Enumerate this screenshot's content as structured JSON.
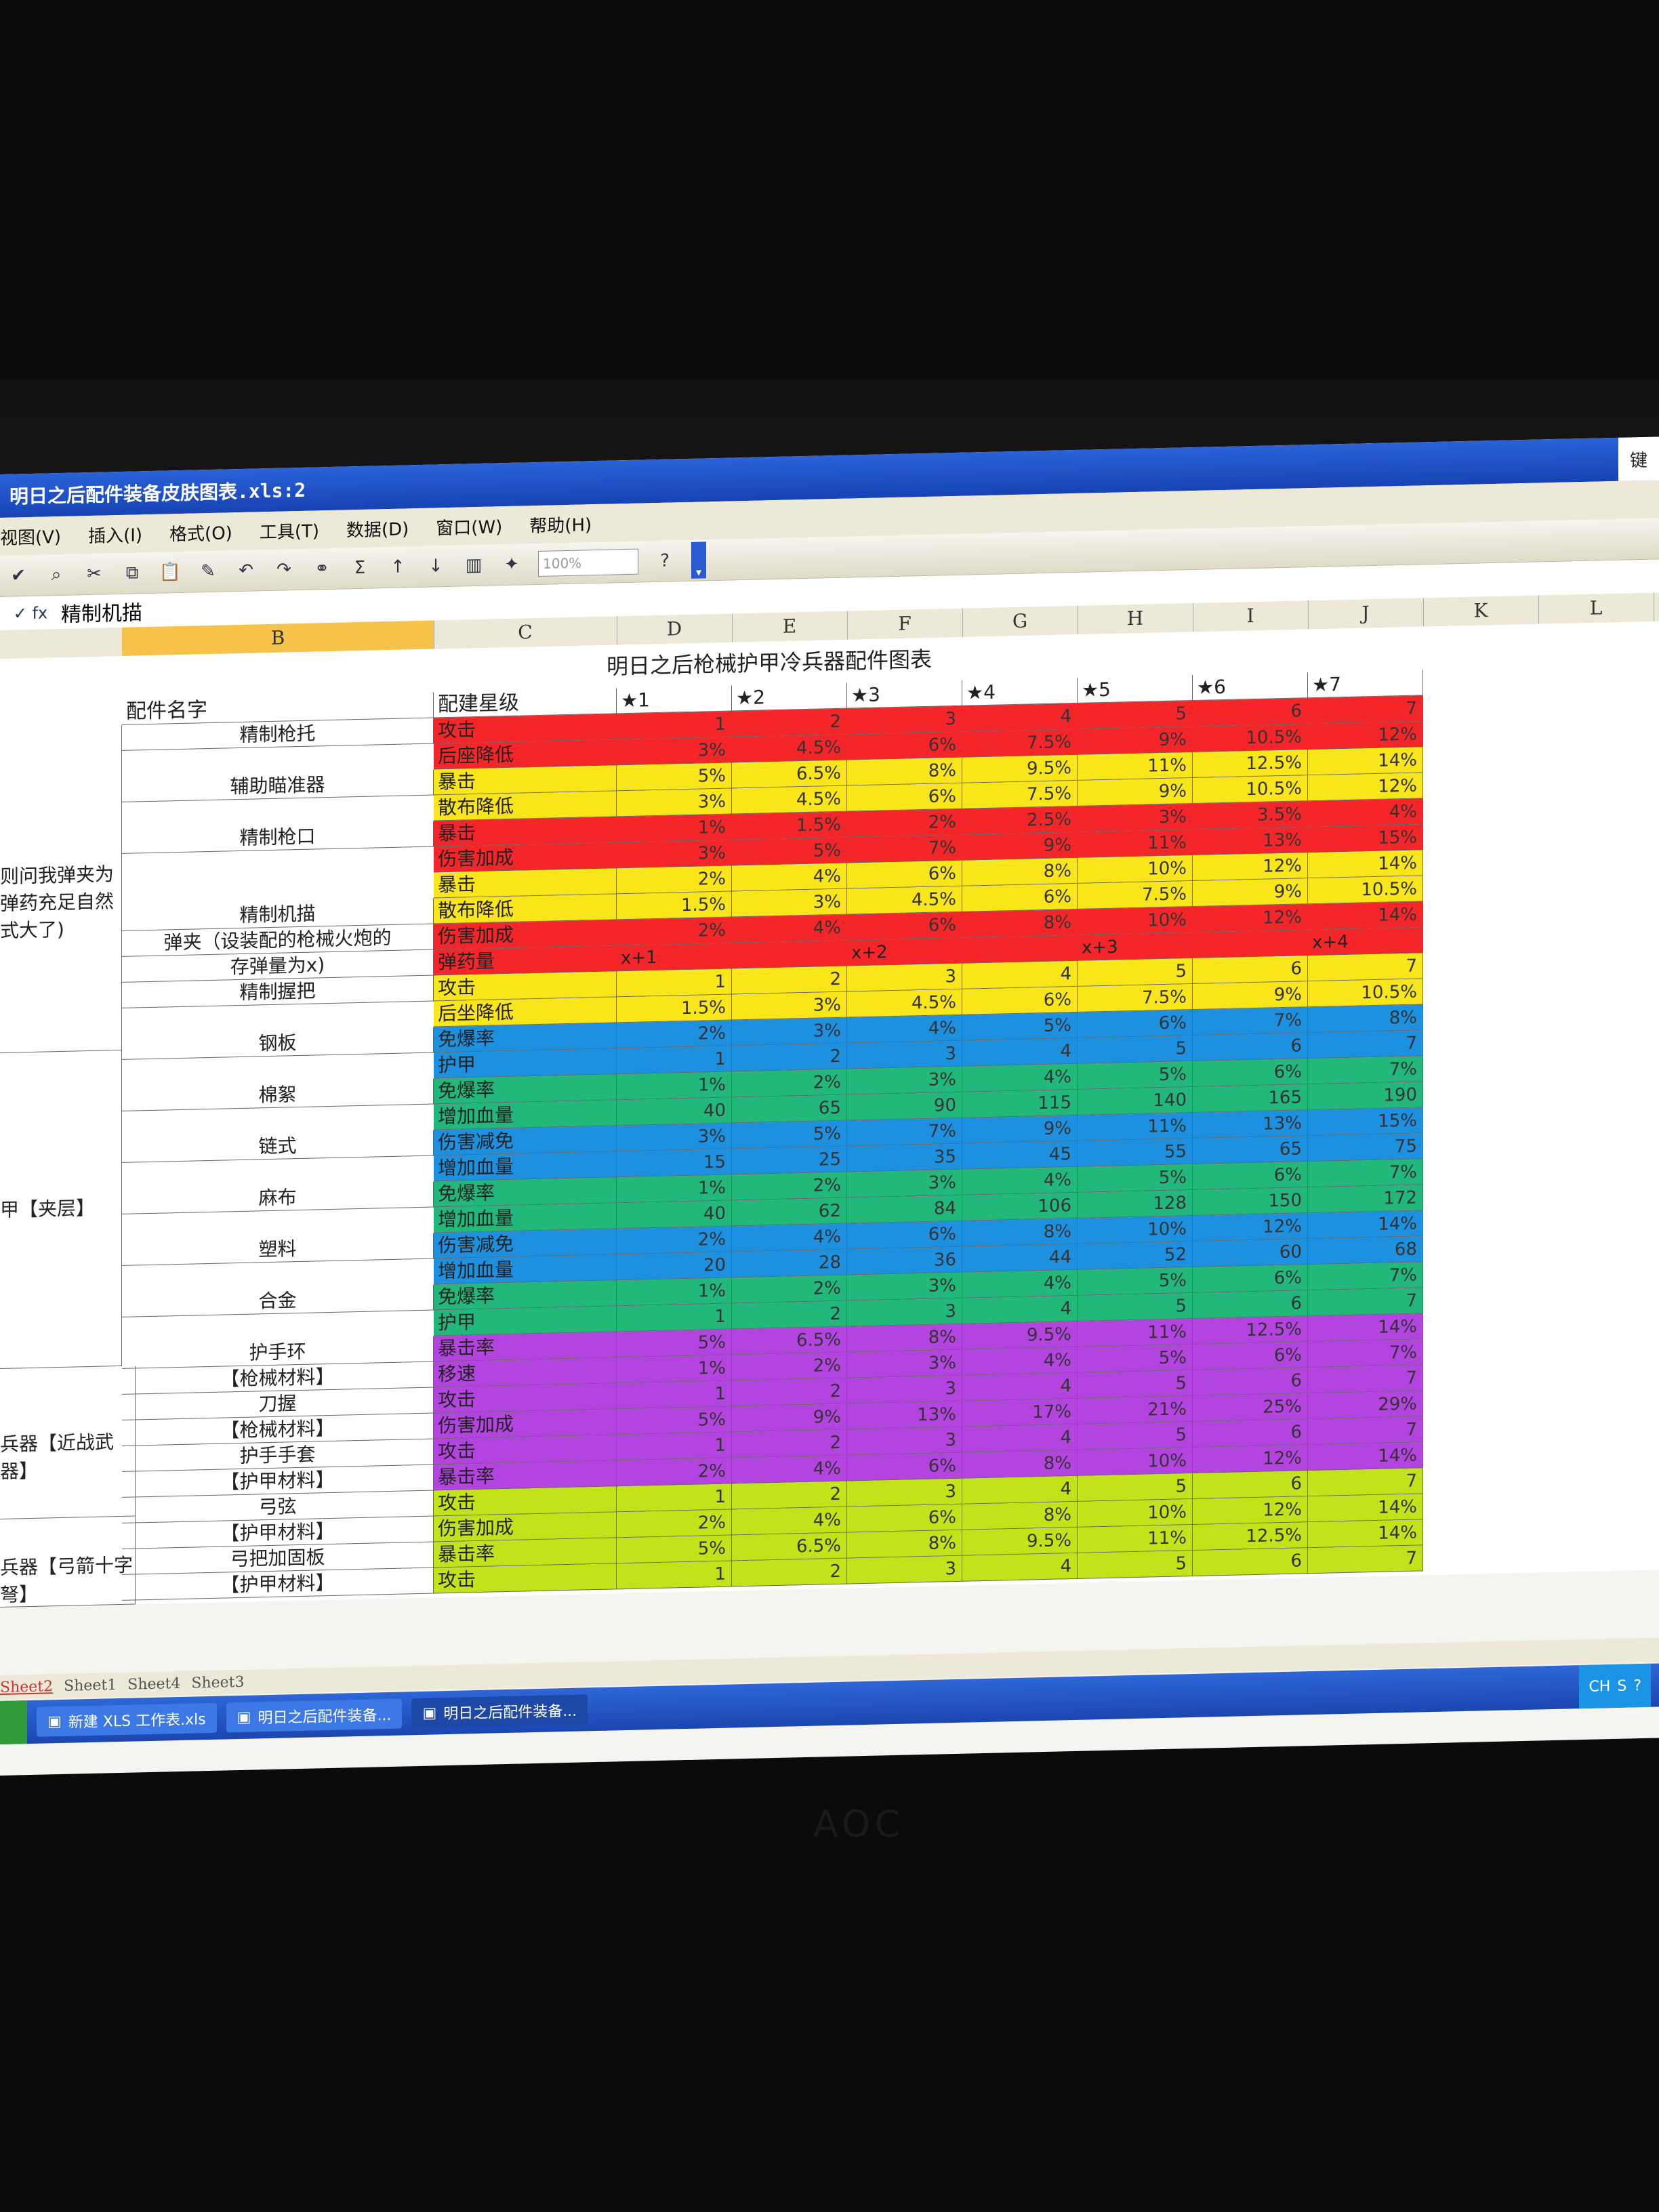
{
  "window": {
    "title": "明日之后配件装备皮肤图表.xls:2",
    "right_label": "键"
  },
  "menu": [
    "视图(V)",
    "插入(I)",
    "格式(O)",
    "工具(T)",
    "数据(D)",
    "窗口(W)",
    "帮助(H)"
  ],
  "toolbar": {
    "zoom": "100%"
  },
  "formula_bar": {
    "content": "精制机描"
  },
  "columns": [
    "B",
    "C",
    "D",
    "E",
    "F",
    "G",
    "H",
    "I",
    "J",
    "K",
    "L"
  ],
  "sheet_title": "明日之后枪械护甲冷兵器配件图表",
  "header": {
    "name_label": "配件名字",
    "level_label": "配建星级",
    "stars": [
      "★1",
      "★2",
      "★3",
      "★4",
      "★5",
      "★6",
      "★7"
    ]
  },
  "side_notes": {
    "gun_note": "则问我弹夹为 弹药充足自然 式大了)",
    "armor_group": "甲【夹层】",
    "melee_group": "兵器【近战武器】",
    "bow_group": "兵器【弓箭十字弩】"
  },
  "rows": [
    {
      "name": "精制枪托",
      "attr": "攻击",
      "color": "#f4262a",
      "values": [
        "1",
        "2",
        "3",
        "4",
        "5",
        "6",
        "7"
      ]
    },
    {
      "name": "",
      "attr": "后座降低",
      "color": "#f4262a",
      "values": [
        "3%",
        "4.5%",
        "6%",
        "7.5%",
        "9%",
        "10.5%",
        "12%"
      ]
    },
    {
      "name": "辅助瞄准器",
      "attr": "暴击",
      "color": "#f8e61a",
      "values": [
        "5%",
        "6.5%",
        "8%",
        "9.5%",
        "11%",
        "12.5%",
        "14%"
      ]
    },
    {
      "name": "",
      "attr": "散布降低",
      "color": "#f8e61a",
      "values": [
        "3%",
        "4.5%",
        "6%",
        "7.5%",
        "9%",
        "10.5%",
        "12%"
      ]
    },
    {
      "name": "精制枪口",
      "attr": "暴击",
      "color": "#f4262a",
      "values": [
        "1%",
        "1.5%",
        "2%",
        "2.5%",
        "3%",
        "3.5%",
        "4%"
      ]
    },
    {
      "name": "",
      "attr": "伤害加成",
      "color": "#f4262a",
      "values": [
        "3%",
        "5%",
        "7%",
        "9%",
        "11%",
        "13%",
        "15%"
      ]
    },
    {
      "name": "",
      "attr": "暴击",
      "color": "#f8e61a",
      "values": [
        "2%",
        "4%",
        "6%",
        "8%",
        "10%",
        "12%",
        "14%"
      ]
    },
    {
      "name": "精制机描",
      "attr": "散布降低",
      "color": "#f8e61a",
      "values": [
        "1.5%",
        "3%",
        "4.5%",
        "6%",
        "7.5%",
        "9%",
        "10.5%"
      ]
    },
    {
      "name": "弹夹（设装配的枪械火炮的",
      "attr": "伤害加成",
      "color": "#f4262a",
      "values": [
        "2%",
        "4%",
        "6%",
        "8%",
        "10%",
        "12%",
        "14%"
      ]
    },
    {
      "name": "存弹量为x)",
      "attr": "弹药量",
      "color": "#f4262a",
      "values": [
        "x+1",
        "",
        "x+2",
        "",
        "x+3",
        "",
        "x+4"
      ]
    },
    {
      "name": "精制握把",
      "attr": "攻击",
      "color": "#f8e61a",
      "values": [
        "1",
        "2",
        "3",
        "4",
        "5",
        "6",
        "7"
      ]
    },
    {
      "name": "",
      "attr": "后坐降低",
      "color": "#f8e61a",
      "values": [
        "1.5%",
        "3%",
        "4.5%",
        "6%",
        "7.5%",
        "9%",
        "10.5%"
      ]
    },
    {
      "name": "钢板",
      "attr": "免爆率",
      "color": "#1e90e0",
      "values": [
        "2%",
        "3%",
        "4%",
        "5%",
        "6%",
        "7%",
        "8%"
      ]
    },
    {
      "name": "",
      "attr": "护甲",
      "color": "#1e90e0",
      "values": [
        "1",
        "2",
        "3",
        "4",
        "5",
        "6",
        "7"
      ]
    },
    {
      "name": "棉絮",
      "attr": "免爆率",
      "color": "#22b87a",
      "values": [
        "1%",
        "2%",
        "3%",
        "4%",
        "5%",
        "6%",
        "7%"
      ]
    },
    {
      "name": "",
      "attr": "增加血量",
      "color": "#22b87a",
      "values": [
        "40",
        "65",
        "90",
        "115",
        "140",
        "165",
        "190"
      ]
    },
    {
      "name": "链式",
      "attr": "伤害减免",
      "color": "#1e90e0",
      "values": [
        "3%",
        "5%",
        "7%",
        "9%",
        "11%",
        "13%",
        "15%"
      ]
    },
    {
      "name": "",
      "attr": "增加血量",
      "color": "#1e90e0",
      "values": [
        "15",
        "25",
        "35",
        "45",
        "55",
        "65",
        "75"
      ]
    },
    {
      "name": "麻布",
      "attr": "免爆率",
      "color": "#22b87a",
      "values": [
        "1%",
        "2%",
        "3%",
        "4%",
        "5%",
        "6%",
        "7%"
      ]
    },
    {
      "name": "",
      "attr": "增加血量",
      "color": "#22b87a",
      "values": [
        "40",
        "62",
        "84",
        "106",
        "128",
        "150",
        "172"
      ]
    },
    {
      "name": "塑料",
      "attr": "伤害减免",
      "color": "#1e90e0",
      "values": [
        "2%",
        "4%",
        "6%",
        "8%",
        "10%",
        "12%",
        "14%"
      ]
    },
    {
      "name": "",
      "attr": "增加血量",
      "color": "#1e90e0",
      "values": [
        "20",
        "28",
        "36",
        "44",
        "52",
        "60",
        "68"
      ]
    },
    {
      "name": "合金",
      "attr": "免爆率",
      "color": "#22b87a",
      "values": [
        "1%",
        "2%",
        "3%",
        "4%",
        "5%",
        "6%",
        "7%"
      ]
    },
    {
      "name": "",
      "attr": "护甲",
      "color": "#22b87a",
      "values": [
        "1",
        "2",
        "3",
        "4",
        "5",
        "6",
        "7"
      ]
    },
    {
      "name": "护手环",
      "attr": "暴击率",
      "color": "#b444e0",
      "values": [
        "5%",
        "6.5%",
        "8%",
        "9.5%",
        "11%",
        "12.5%",
        "14%"
      ]
    },
    {
      "name": "【枪械材料】",
      "attr": "移速",
      "color": "#b444e0",
      "values": [
        "1%",
        "2%",
        "3%",
        "4%",
        "5%",
        "6%",
        "7%"
      ]
    },
    {
      "name": "刀握",
      "attr": "攻击",
      "color": "#b444e0",
      "values": [
        "1",
        "2",
        "3",
        "4",
        "5",
        "6",
        "7"
      ]
    },
    {
      "name": "【枪械材料】",
      "attr": "伤害加成",
      "color": "#b444e0",
      "values": [
        "5%",
        "9%",
        "13%",
        "17%",
        "21%",
        "25%",
        "29%"
      ]
    },
    {
      "name": "护手手套",
      "attr": "攻击",
      "color": "#b444e0",
      "values": [
        "1",
        "2",
        "3",
        "4",
        "5",
        "6",
        "7"
      ]
    },
    {
      "name": "【护甲材料】",
      "attr": "暴击率",
      "color": "#b444e0",
      "values": [
        "2%",
        "4%",
        "6%",
        "8%",
        "10%",
        "12%",
        "14%"
      ]
    },
    {
      "name": "弓弦",
      "attr": "攻击",
      "color": "#c4e21a",
      "values": [
        "1",
        "2",
        "3",
        "4",
        "5",
        "6",
        "7"
      ]
    },
    {
      "name": "【护甲材料】",
      "attr": "伤害加成",
      "color": "#c4e21a",
      "values": [
        "2%",
        "4%",
        "6%",
        "8%",
        "10%",
        "12%",
        "14%"
      ]
    },
    {
      "name": "弓把加固板",
      "attr": "暴击率",
      "color": "#c4e21a",
      "values": [
        "5%",
        "6.5%",
        "8%",
        "9.5%",
        "11%",
        "12.5%",
        "14%"
      ]
    },
    {
      "name": "【护甲材料】",
      "attr": "攻击",
      "color": "#c4e21a",
      "values": [
        "1",
        "2",
        "3",
        "4",
        "5",
        "6",
        "7"
      ]
    }
  ],
  "sheet_tabs": [
    "Sheet2",
    "Sheet1",
    "Sheet4",
    "Sheet3"
  ],
  "taskbar": {
    "items": [
      "新建 XLS 工作表.xls",
      "明日之后配件装备...",
      "明日之后配件装备..."
    ],
    "tray": "CH"
  },
  "monitor_brand": "AOC"
}
